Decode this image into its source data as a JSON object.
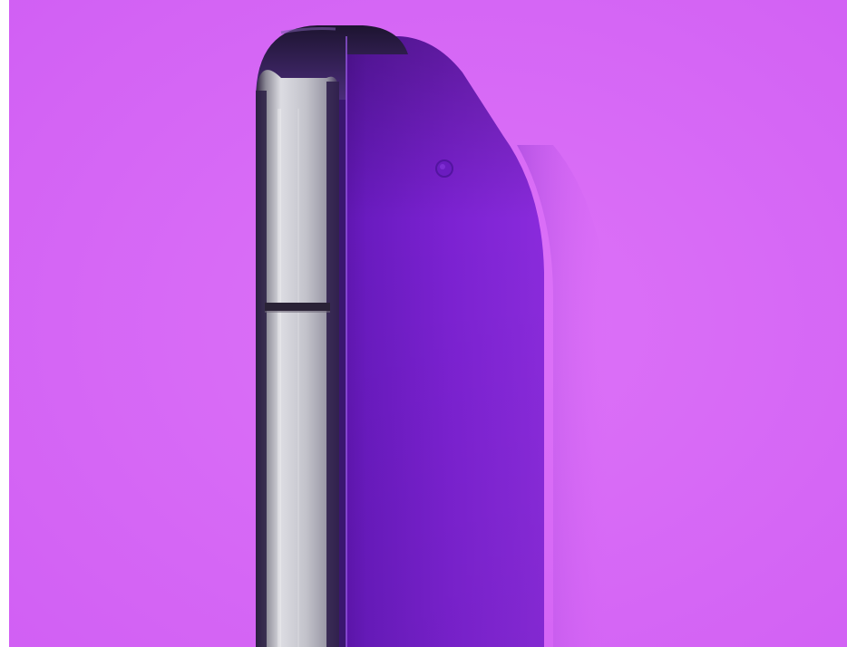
{
  "photo": {
    "subject": "smartphone-side-profile",
    "colors": {
      "background": "#d463f5",
      "background_light": "#dd73f8",
      "screen": "#7a1fd0",
      "screen_dark": "#5a14a8",
      "frame_metal": "#cfcfd6",
      "frame_dark": "#3b2a52",
      "antenna_band": "#2a2236"
    }
  }
}
